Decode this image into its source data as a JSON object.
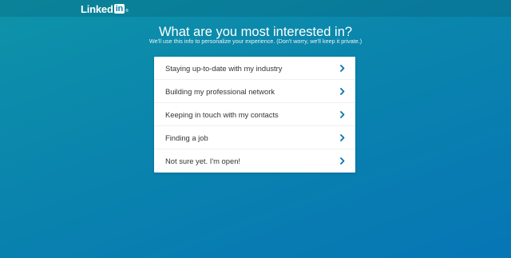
{
  "header": {
    "logo_text": "Linked",
    "logo_box_text": "in",
    "logo_tm": "®"
  },
  "main": {
    "title": "What are you most interested in?",
    "subtitle": "We'll use this info to personalize your experience. (Don't worry, we'll keep it private.)",
    "options": [
      {
        "label": "Staying up-to-date with my industry",
        "icon": "chevron-right-icon"
      },
      {
        "label": "Building my professional network",
        "icon": "chevron-right-icon"
      },
      {
        "label": "Keeping in touch with my contacts",
        "icon": "chevron-right-icon"
      },
      {
        "label": "Finding a job",
        "icon": "chevron-right-icon"
      },
      {
        "label": "Not sure yet. I'm open!",
        "icon": "chevron-right-icon"
      }
    ]
  },
  "colors": {
    "brand_blue": "#0a84ad",
    "chevron": "#0a73b1",
    "text": "#333333"
  }
}
